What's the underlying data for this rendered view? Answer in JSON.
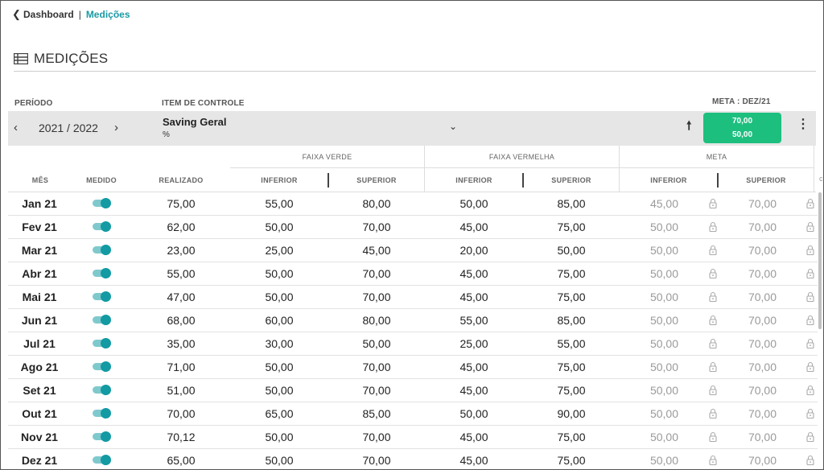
{
  "breadcrumb": {
    "back_label": "Dashboard",
    "separator": "|",
    "current": "Medições"
  },
  "page": {
    "title": "MEDIÇÕES"
  },
  "filters": {
    "period_label": "PERÍODO",
    "period_value": "2021 / 2022",
    "item_label": "ITEM DE CONTROLE",
    "item_name": "Saving Geral",
    "item_unit": "%",
    "meta_label": "META : DEZ/21",
    "meta_values": [
      "70,00",
      "50,00"
    ]
  },
  "table": {
    "group_headers": {
      "faixa_verde": "FAIXA VERDE",
      "faixa_vermelha": "FAIXA VERMELHA",
      "meta": "META"
    },
    "columns": {
      "mes": "MÊS",
      "medido": "MEDIDO",
      "realizado": "REALIZADO",
      "inferior": "INFERIOR",
      "superior": "SUPERIOR"
    },
    "rows": [
      {
        "mes": "Jan 21",
        "medido": true,
        "realizado": "75,00",
        "verde_inf": "55,00",
        "verde_sup": "80,00",
        "verm_inf": "50,00",
        "verm_sup": "85,00",
        "meta_inf": "45,00",
        "meta_sup": "70,00"
      },
      {
        "mes": "Fev 21",
        "medido": true,
        "realizado": "62,00",
        "verde_inf": "50,00",
        "verde_sup": "70,00",
        "verm_inf": "45,00",
        "verm_sup": "75,00",
        "meta_inf": "50,00",
        "meta_sup": "70,00"
      },
      {
        "mes": "Mar 21",
        "medido": true,
        "realizado": "23,00",
        "verde_inf": "25,00",
        "verde_sup": "45,00",
        "verm_inf": "20,00",
        "verm_sup": "50,00",
        "meta_inf": "50,00",
        "meta_sup": "70,00"
      },
      {
        "mes": "Abr 21",
        "medido": true,
        "realizado": "55,00",
        "verde_inf": "50,00",
        "verde_sup": "70,00",
        "verm_inf": "45,00",
        "verm_sup": "75,00",
        "meta_inf": "50,00",
        "meta_sup": "70,00"
      },
      {
        "mes": "Mai 21",
        "medido": true,
        "realizado": "47,00",
        "verde_inf": "50,00",
        "verde_sup": "70,00",
        "verm_inf": "45,00",
        "verm_sup": "75,00",
        "meta_inf": "50,00",
        "meta_sup": "70,00"
      },
      {
        "mes": "Jun 21",
        "medido": true,
        "realizado": "68,00",
        "verde_inf": "60,00",
        "verde_sup": "80,00",
        "verm_inf": "55,00",
        "verm_sup": "85,00",
        "meta_inf": "50,00",
        "meta_sup": "70,00"
      },
      {
        "mes": "Jul 21",
        "medido": true,
        "realizado": "35,00",
        "verde_inf": "30,00",
        "verde_sup": "50,00",
        "verm_inf": "25,00",
        "verm_sup": "55,00",
        "meta_inf": "50,00",
        "meta_sup": "70,00"
      },
      {
        "mes": "Ago 21",
        "medido": true,
        "realizado": "71,00",
        "verde_inf": "50,00",
        "verde_sup": "70,00",
        "verm_inf": "45,00",
        "verm_sup": "75,00",
        "meta_inf": "50,00",
        "meta_sup": "70,00"
      },
      {
        "mes": "Set 21",
        "medido": true,
        "realizado": "51,00",
        "verde_inf": "50,00",
        "verde_sup": "70,00",
        "verm_inf": "45,00",
        "verm_sup": "75,00",
        "meta_inf": "50,00",
        "meta_sup": "70,00"
      },
      {
        "mes": "Out 21",
        "medido": true,
        "realizado": "70,00",
        "verde_inf": "65,00",
        "verde_sup": "85,00",
        "verm_inf": "50,00",
        "verm_sup": "90,00",
        "meta_inf": "50,00",
        "meta_sup": "70,00"
      },
      {
        "mes": "Nov 21",
        "medido": true,
        "realizado": "70,12",
        "verde_inf": "50,00",
        "verde_sup": "70,00",
        "verm_inf": "45,00",
        "verm_sup": "75,00",
        "meta_inf": "50,00",
        "meta_sup": "70,00"
      },
      {
        "mes": "Dez 21",
        "medido": true,
        "realizado": "65,00",
        "verde_inf": "50,00",
        "verde_sup": "70,00",
        "verm_inf": "45,00",
        "verm_sup": "75,00",
        "meta_inf": "50,00",
        "meta_sup": "70,00"
      }
    ]
  },
  "colors": {
    "accent": "#1a9aa4",
    "meta_badge": "#1dbf7f",
    "toggle_on": "#139aa3",
    "filter_bar": "#e6e6e6",
    "muted_text": "#9a9a9a"
  },
  "icons": {
    "back": "chevron-left-icon",
    "title": "table-list-icon",
    "prev": "chevron-left-icon",
    "next": "chevron-right-icon",
    "dropdown": "chevron-down-icon",
    "meta_direction": "arrow-up-icon",
    "menu": "kebab-menu-icon",
    "lock": "lock-icon"
  }
}
